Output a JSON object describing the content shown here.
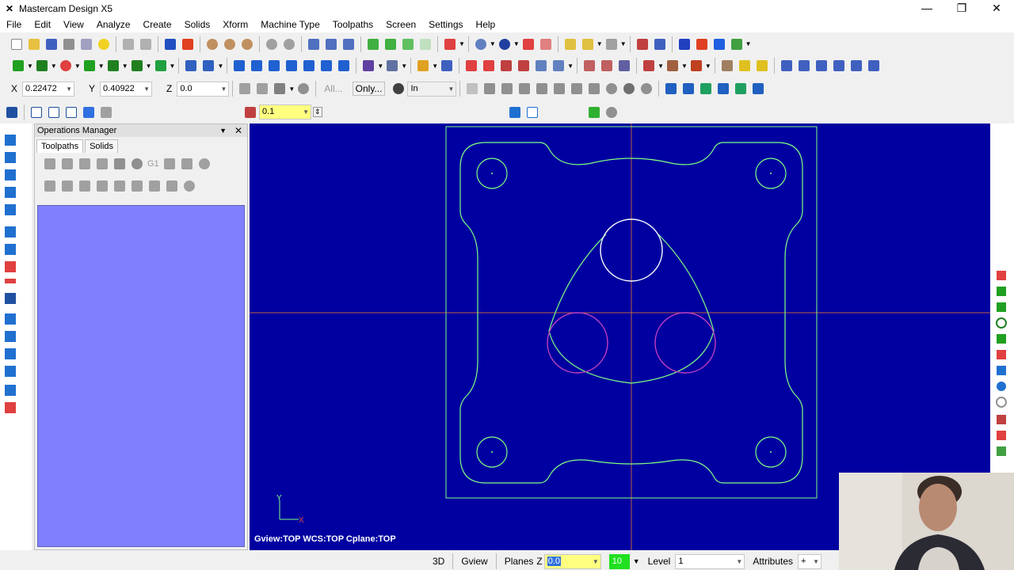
{
  "window": {
    "title": "Mastercam Design X5"
  },
  "menu": [
    "File",
    "Edit",
    "View",
    "Analyze",
    "Create",
    "Solids",
    "Xform",
    "Machine Type",
    "Toolpaths",
    "Screen",
    "Settings",
    "Help"
  ],
  "coords": {
    "x_label": "X",
    "x_value": "0.22472",
    "y_label": "Y",
    "y_value": "0.40922",
    "z_label": "Z",
    "z_value": "0.0"
  },
  "selection": {
    "all_label": "All...",
    "only_label": "Only...",
    "in_value": "In"
  },
  "ribbon": {
    "value": "0.1"
  },
  "ops_manager": {
    "title": "Operations Manager",
    "tabs": [
      "Toolpaths",
      "Solids"
    ],
    "g1_label": "G1"
  },
  "viewport": {
    "view_info": "Gview:TOP  WCS:TOP  Cplane:TOP",
    "axis_y": "Y",
    "axis_x": "X"
  },
  "status": {
    "mode_3d": "3D",
    "gview": "Gview",
    "planes": "Planes",
    "z_label": "Z",
    "z_value": "0.0",
    "color_value": "10",
    "level_label": "Level",
    "level_value": "1",
    "attributes": "Attributes",
    "plus": "+"
  },
  "colors": {
    "viewport_bg": "#0000a0",
    "geometry": "#80ff80",
    "selected": "#ffffff",
    "arcs": "#c040c0",
    "axis": "#c06040",
    "ops_area": "#8080ff"
  }
}
